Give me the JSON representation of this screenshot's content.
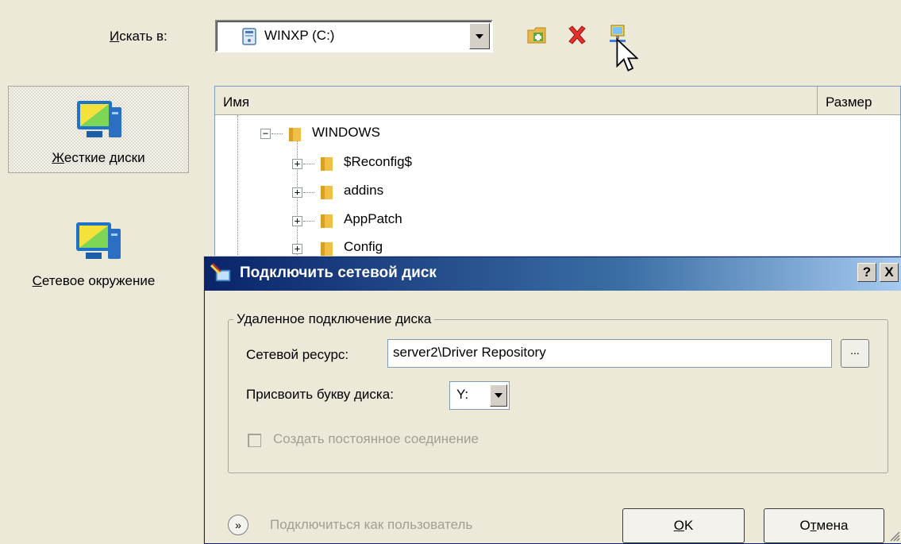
{
  "toolbar": {
    "look_in_label": "Искать в:",
    "look_in_accesskey": "И",
    "look_in_rest": "скать в:",
    "location_value": "WINXP (C:)"
  },
  "places": {
    "hard_disks": {
      "accesskey": "Ж",
      "rest": "есткие диски",
      "label": "Жесткие диски"
    },
    "network": {
      "accesskey": "С",
      "rest": "етевое окружение",
      "label": "Сетевое окружение"
    }
  },
  "filelist": {
    "columns": [
      "Имя",
      "Размер"
    ],
    "items": [
      {
        "name": "WINDOWS",
        "expanded": true
      },
      {
        "name": "$Reconfig$",
        "expanded": false
      },
      {
        "name": "addins",
        "expanded": false
      },
      {
        "name": "AppPatch",
        "expanded": false
      },
      {
        "name": "Config",
        "expanded": false
      }
    ]
  },
  "dialog": {
    "title": "Подключить сетевой диск",
    "help_label": "?",
    "close_label": "X",
    "group_title": "Удаленное подключение диска",
    "resource_label": "Сетевой ресурс:",
    "resource_value": "server2\\Driver Repository",
    "browse_label": "...",
    "letter_label": "Присвоить букву диска:",
    "letter_value": "Y:",
    "persistent_label": "Создать постоянное соединение",
    "connect_as_label": "Подключиться как пользователь",
    "ok_label": "OK",
    "ok_accesskey": "O",
    "ok_rest": "K",
    "cancel_label": "Отмена",
    "cancel_pre": "О",
    "cancel_accesskey": "т",
    "cancel_rest": "мена"
  },
  "colors": {
    "titlebar_start": "#0a246a",
    "titlebar_end": "#a6caf0",
    "window_bg": "#ece9d8"
  }
}
